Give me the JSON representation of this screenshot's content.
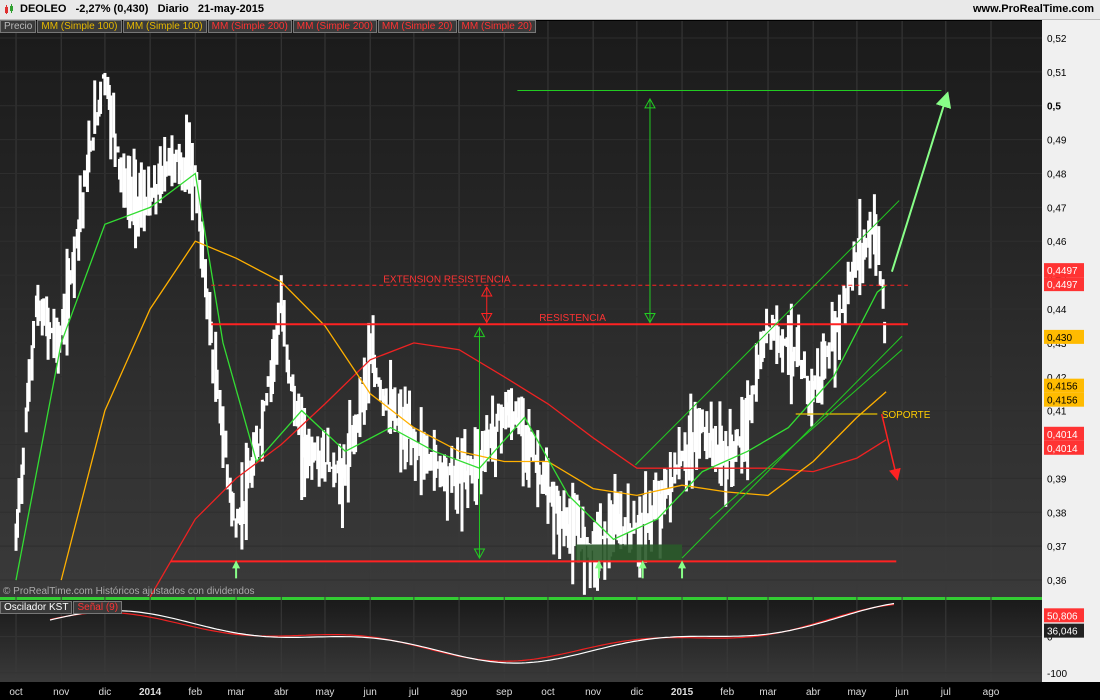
{
  "header": {
    "ticker": "DEOLEO",
    "change": "-2,27% (0,430)",
    "period": "Diario",
    "date": "21-may-2015",
    "site": "www.ProRealTime.com"
  },
  "legend": [
    {
      "label": "Precio",
      "color": "#bbbbbb"
    },
    {
      "label": "MM (Simple 100)",
      "color": "#e6b800"
    },
    {
      "label": "MM (Simple 100)",
      "color": "#e6b800"
    },
    {
      "label": "MM (Simple 200)",
      "color": "#ff3333"
    },
    {
      "label": "MM (Simple 200)",
      "color": "#ff3333"
    },
    {
      "label": "MM (Simple 20)",
      "color": "#ff3333"
    },
    {
      "label": "MM (Simple 20)",
      "color": "#ff3333"
    }
  ],
  "copyright": "© ProRealTime.com  Históricos ajustados con dividendos",
  "kst_legend": [
    {
      "label": "Oscilador KST",
      "color": "#ffffff"
    },
    {
      "label": "Señal (9)",
      "color": "#ff3333"
    }
  ],
  "colors": {
    "price": "#ffffff",
    "sma20": "#33dd33",
    "sma100": "#ffb000",
    "sma200": "#ee2222",
    "resistance": "#ff2222",
    "channel": "#22cc22",
    "projection": "#88ff88",
    "support": "#e6c000"
  },
  "chart_data": [
    {
      "type": "line",
      "ylim": [
        0.355,
        0.525
      ],
      "x_axis_labels": [
        "oct",
        "nov",
        "dic",
        "2014",
        "feb",
        "mar",
        "abr",
        "may",
        "jun",
        "jul",
        "ago",
        "sep",
        "oct",
        "nov",
        "dic",
        "2015",
        "feb",
        "mar",
        "abr",
        "may",
        "jun",
        "jul",
        "ago"
      ],
      "y_ticks": [
        "0,36",
        "0,37",
        "0,38",
        "0,39",
        "0,4",
        "0,41",
        "0,42",
        "0,43",
        "0,44",
        "0,45",
        "0,46",
        "0,47",
        "0,48",
        "0,49",
        "0,5",
        "0,51",
        "0,52"
      ],
      "y_tick_values": [
        0.36,
        0.37,
        0.38,
        0.39,
        0.4,
        0.41,
        0.42,
        0.43,
        0.44,
        0.45,
        0.46,
        0.47,
        0.48,
        0.49,
        0.5,
        0.51,
        0.52
      ],
      "y_badges": [
        {
          "label": "0,4497",
          "value": 0.4497,
          "color": "#ff3333"
        },
        {
          "label": "0,4497",
          "value": 0.4497,
          "color": "#ff3333"
        },
        {
          "label": "0,430",
          "value": 0.43,
          "color": "#ffbb00"
        },
        {
          "label": "0,4156",
          "value": 0.4156,
          "color": "#ffbb00"
        },
        {
          "label": "0,4156",
          "value": 0.4156,
          "color": "#ffbb00"
        },
        {
          "label": "0,4014",
          "value": 0.4014,
          "color": "#ff3333"
        },
        {
          "label": "0,4014",
          "value": 0.4014,
          "color": "#ff3333"
        }
      ],
      "series": [
        {
          "key": "price",
          "x": [
            "2013-10-01",
            "2013-10-15",
            "2013-11-01",
            "2013-11-15",
            "2013-12-01",
            "2013-12-15",
            "2014-01-01",
            "2014-01-15",
            "2014-02-01",
            "2014-02-15",
            "2014-03-01",
            "2014-03-15",
            "2014-04-01",
            "2014-04-15",
            "2014-05-01",
            "2014-05-15",
            "2014-06-01",
            "2014-06-15",
            "2014-07-01",
            "2014-07-15",
            "2014-08-01",
            "2014-08-15",
            "2014-09-01",
            "2014-09-15",
            "2014-10-01",
            "2014-10-15",
            "2014-11-01",
            "2014-11-15",
            "2014-12-01",
            "2014-12-15",
            "2015-01-01",
            "2015-01-15",
            "2015-02-01",
            "2015-02-15",
            "2015-03-01",
            "2015-03-15",
            "2015-04-01",
            "2015-04-15",
            "2015-05-01",
            "2015-05-15",
            "2015-05-21"
          ],
          "y": [
            0.37,
            0.44,
            0.43,
            0.47,
            0.51,
            0.475,
            0.47,
            0.485,
            0.48,
            0.42,
            0.375,
            0.395,
            0.44,
            0.4,
            0.395,
            0.39,
            0.425,
            0.41,
            0.4,
            0.395,
            0.39,
            0.395,
            0.41,
            0.405,
            0.385,
            0.375,
            0.37,
            0.375,
            0.375,
            0.38,
            0.395,
            0.405,
            0.395,
            0.405,
            0.435,
            0.43,
            0.415,
            0.43,
            0.455,
            0.465,
            0.43
          ]
        },
        {
          "key": "sma20",
          "x": [
            "2013-10-01",
            "2013-11-01",
            "2013-12-01",
            "2014-01-01",
            "2014-02-01",
            "2014-02-20",
            "2014-03-15",
            "2014-04-15",
            "2014-05-15",
            "2014-06-15",
            "2014-07-15",
            "2014-08-15",
            "2014-09-15",
            "2014-10-15",
            "2014-11-15",
            "2014-12-15",
            "2015-01-15",
            "2015-02-15",
            "2015-03-15",
            "2015-04-15",
            "2015-05-15",
            "2015-05-21"
          ],
          "y": [
            0.36,
            0.43,
            0.465,
            0.47,
            0.48,
            0.43,
            0.395,
            0.41,
            0.398,
            0.405,
            0.398,
            0.393,
            0.408,
            0.385,
            0.372,
            0.378,
            0.392,
            0.398,
            0.405,
            0.42,
            0.445,
            0.447
          ]
        },
        {
          "key": "sma100",
          "x": [
            "2013-11-01",
            "2013-12-01",
            "2014-01-01",
            "2014-02-01",
            "2014-03-01",
            "2014-04-01",
            "2014-05-01",
            "2014-06-01",
            "2014-07-01",
            "2014-08-01",
            "2014-09-01",
            "2014-10-01",
            "2014-11-01",
            "2014-12-01",
            "2015-01-01",
            "2015-02-01",
            "2015-03-01",
            "2015-04-01",
            "2015-05-01",
            "2015-05-21"
          ],
          "y": [
            0.36,
            0.41,
            0.44,
            0.46,
            0.455,
            0.448,
            0.435,
            0.415,
            0.405,
            0.398,
            0.395,
            0.395,
            0.387,
            0.385,
            0.388,
            0.386,
            0.385,
            0.395,
            0.408,
            0.4156
          ]
        },
        {
          "key": "sma200",
          "x": [
            "2014-01-01",
            "2014-02-01",
            "2014-03-01",
            "2014-04-01",
            "2014-05-01",
            "2014-06-01",
            "2014-07-01",
            "2014-08-01",
            "2014-09-01",
            "2014-10-01",
            "2014-11-01",
            "2014-12-01",
            "2015-01-01",
            "2015-02-01",
            "2015-03-01",
            "2015-04-01",
            "2015-05-01",
            "2015-05-21"
          ],
          "y": [
            0.355,
            0.378,
            0.39,
            0.4,
            0.412,
            0.425,
            0.43,
            0.428,
            0.42,
            0.412,
            0.402,
            0.393,
            0.393,
            0.393,
            0.393,
            0.392,
            0.396,
            0.4014
          ]
        }
      ],
      "annotations": [
        {
          "text": "EXTENSION RESISTENCIA",
          "value": 0.447,
          "color": "#ff3333"
        },
        {
          "text": "RESISTENCIA",
          "value": 0.4355,
          "color": "#ff3333"
        },
        {
          "text": "SOPORTE",
          "value": 0.409,
          "color": "#ffcc00"
        }
      ]
    },
    {
      "type": "line",
      "title": "Oscilador KST",
      "y_ticks": [
        "0",
        "-100"
      ],
      "y_tick_values": [
        0,
        -100
      ],
      "y_badges": [
        {
          "label": "50,806",
          "value": 50.806,
          "color": "#ff3333"
        },
        {
          "label": "36,046",
          "value": 36.046,
          "color": "#222222"
        }
      ],
      "series": [
        {
          "key": "kst",
          "name": "Oscilador KST"
        },
        {
          "key": "signal",
          "name": "Señal (9)"
        }
      ]
    }
  ]
}
